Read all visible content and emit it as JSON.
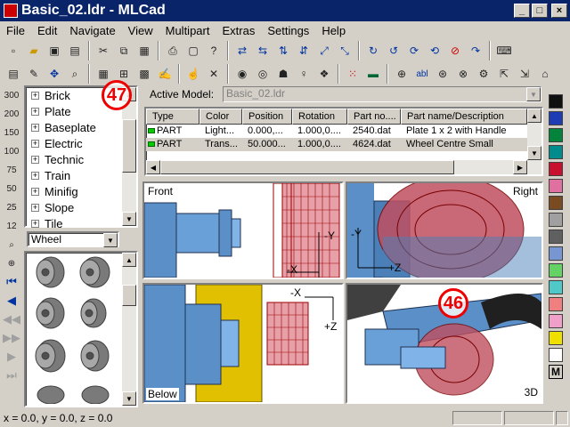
{
  "window": {
    "title": "Basic_02.ldr - MLCad",
    "minimize": "_",
    "maximize": "□",
    "close": "×"
  },
  "menu": [
    "File",
    "Edit",
    "Navigate",
    "View",
    "Multipart",
    "Extras",
    "Settings",
    "Help"
  ],
  "toolbar1_icons": [
    "new-icon",
    "open-icon",
    "save-icon",
    "save-as-icon",
    "cut-icon",
    "copy-icon",
    "paste-icon",
    "print-icon",
    "preview-icon",
    "help-icon",
    "move-left-icon",
    "move-right-icon",
    "move-up-icon",
    "move-down-icon",
    "move-front-icon",
    "move-back-icon",
    "rotate-x-icon",
    "rotate-x-neg-icon",
    "rotate-y-icon",
    "rotate-y-neg-icon",
    "rotate-z-icon",
    "keyboard-icon"
  ],
  "toolbar2_icons": [
    "views-icon",
    "edit-icon",
    "move-icon",
    "zoom-icon",
    "grid-icon",
    "table-icon",
    "fill-icon",
    "pen-icon",
    "hand-icon",
    "delete-icon",
    "rotation-icon",
    "ghost-icon",
    "shadow-icon",
    "lamp-icon",
    "bucket-icon",
    "points-icon",
    "book-icon",
    "add-part-icon",
    "text-icon",
    "color-icon",
    "search-icon",
    "replace-icon",
    "export-icon",
    "import-icon",
    "render-icon"
  ],
  "left_tools": [
    "zoom-300",
    "zoom-200",
    "zoom-150",
    "zoom-100",
    "zoom-75",
    "zoom-50",
    "zoom-25",
    "zoom-12",
    "zoom-fit",
    "zoom-center",
    "first-step",
    "prev-step",
    "step-back",
    "step-forward",
    "next-step",
    "last-step"
  ],
  "left_tool_labels": [
    "300",
    "200",
    "150",
    "100",
    "75",
    "50",
    "25",
    "12"
  ],
  "tree": {
    "items": [
      "Brick",
      "Plate",
      "Baseplate",
      "Electric",
      "Technic",
      "Train",
      "Minifig",
      "Slope",
      "Tile"
    ]
  },
  "category": {
    "value": "Wheel"
  },
  "active_model": {
    "label": "Active Model:",
    "value": "Basic_02.ldr"
  },
  "table": {
    "headers": [
      "Type",
      "Color",
      "Position",
      "Rotation",
      "Part no....",
      "Part name/Description"
    ],
    "rows": [
      [
        "PART",
        "Light...",
        "0.000,...",
        "1.000,0....",
        "2540.dat",
        "Plate 1 x 2 with Handle"
      ],
      [
        "PART",
        "Trans...",
        "50.000...",
        "1.000,0....",
        "4624.dat",
        "Wheel Centre Small"
      ]
    ]
  },
  "views": {
    "front": {
      "label": "Front",
      "axis_y": "-Y",
      "axis_x": "-X"
    },
    "right": {
      "label": "Right",
      "axis_y": "-Y",
      "axis_z": "+Z"
    },
    "below": {
      "label": "Below",
      "axis_x": "-X",
      "axis_z": "+Z"
    },
    "threed": {
      "label": "3D"
    }
  },
  "callouts": {
    "a": "47",
    "b": "46"
  },
  "palette": {
    "colors": [
      "#101010",
      "#1e3cb4",
      "#00843c",
      "#008c8c",
      "#c8102e",
      "#e070a0",
      "#7a4a20",
      "#a0a0a0",
      "#606060",
      "#7896d2",
      "#64d264",
      "#50c8c8",
      "#f08080",
      "#f0a0c8",
      "#f0e000",
      "#ffffff"
    ],
    "m_label": "M"
  },
  "status": {
    "coords": "x = 0.0, y = 0.0, z = 0.0"
  }
}
